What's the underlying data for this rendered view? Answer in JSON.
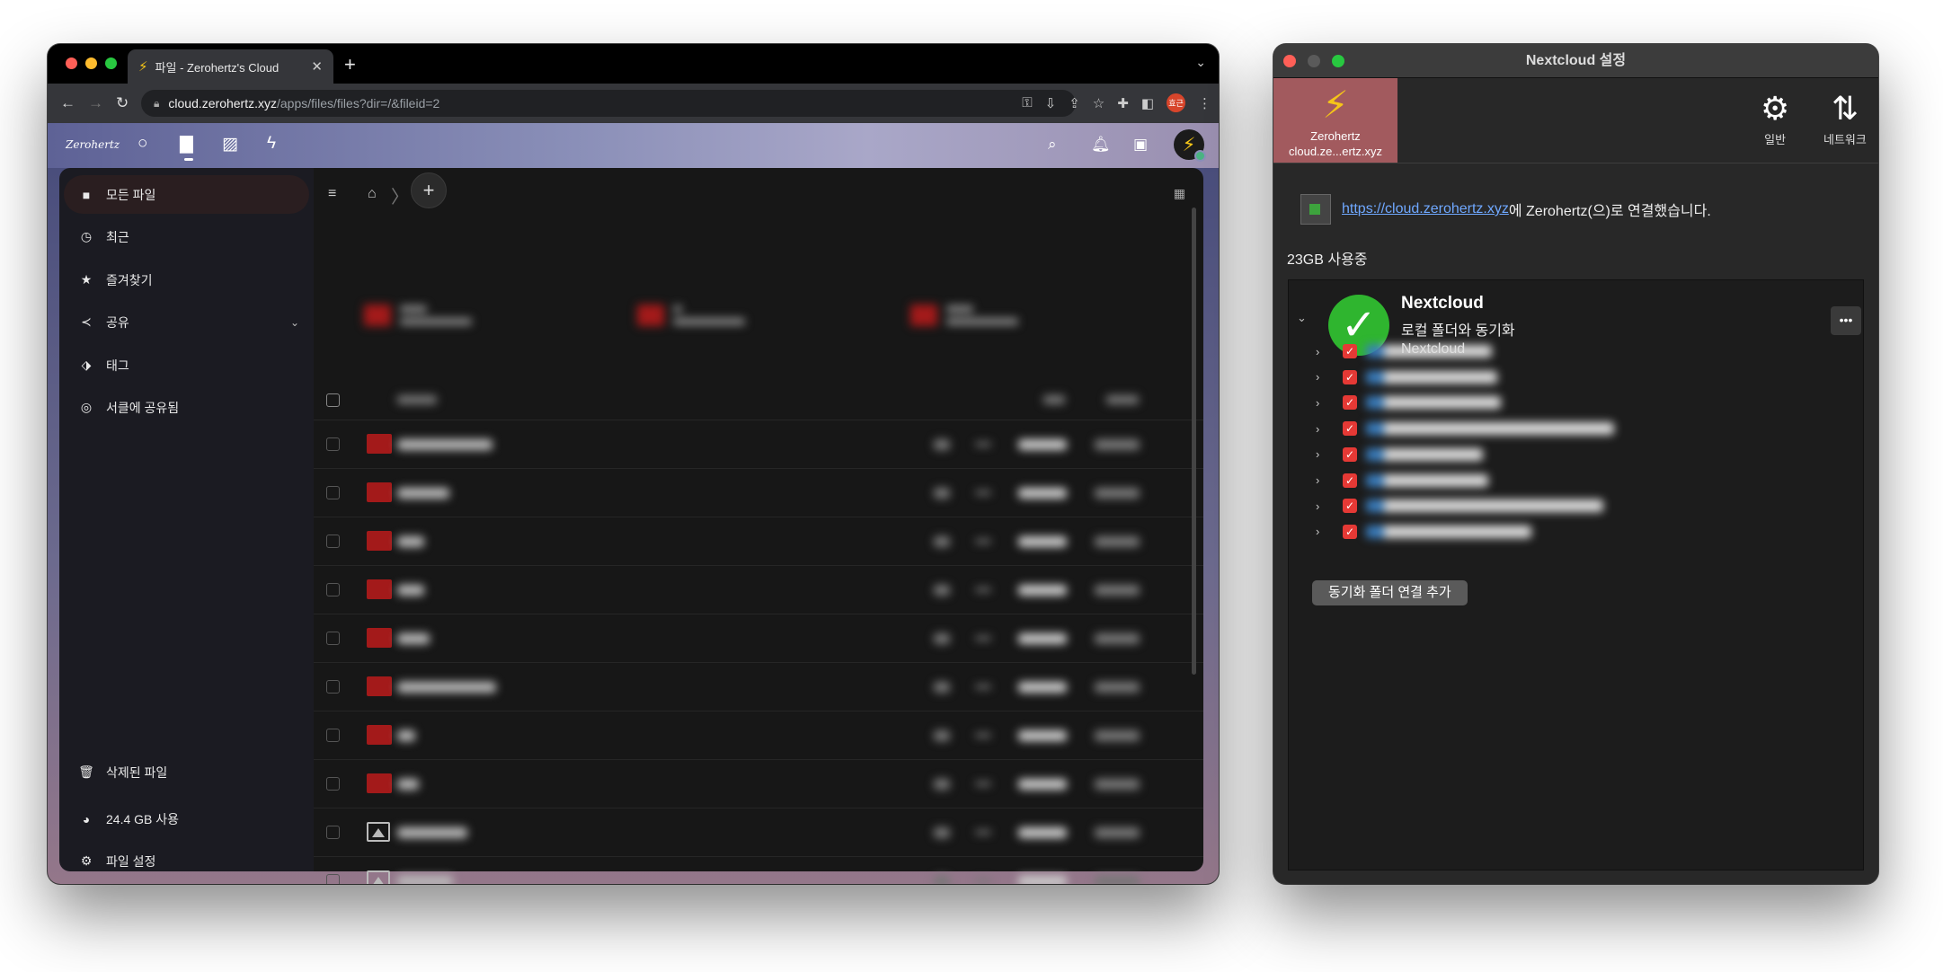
{
  "browser": {
    "tab_title": "파일 - Zerohertz's Cloud",
    "url_host": "cloud.zerohertz.xyz",
    "url_path": "/apps/files/files?dir=/&fileid=2",
    "profile_label": "효근"
  },
  "nextcloud": {
    "logo_text": "Zerohertz",
    "sidebar": {
      "items": [
        {
          "label": "모든 파일"
        },
        {
          "label": "최근"
        },
        {
          "label": "즐겨찾기"
        },
        {
          "label": "공유"
        },
        {
          "label": "태그"
        },
        {
          "label": "서클에 공유됨"
        }
      ],
      "bottom": [
        {
          "label": "삭제된 파일"
        },
        {
          "label": "24.4 GB 사용"
        },
        {
          "label": "파일 설정"
        }
      ]
    },
    "rows": [
      {
        "type": "folder"
      },
      {
        "type": "folder"
      },
      {
        "type": "folder"
      },
      {
        "type": "folder"
      },
      {
        "type": "folder"
      },
      {
        "type": "folder"
      },
      {
        "type": "folder"
      },
      {
        "type": "folder"
      },
      {
        "type": "image"
      },
      {
        "type": "image"
      }
    ]
  },
  "settings": {
    "window_title": "Nextcloud 설정",
    "account_name": "Zerohertz",
    "account_host": "cloud.ze...ertz.xyz",
    "general_label": "일반",
    "network_label": "네트워크",
    "connection_link": "https://cloud.zerohertz.xyz",
    "connection_text": "에 Zerohertz(으)로 연결했습니다.",
    "usage": "23GB 사용중",
    "sync_title": "Nextcloud",
    "sync_subtitle": "로컬 폴더와 동기화",
    "sync_remote": "Nextcloud",
    "folder_count": 8,
    "add_button": "동기화 폴더 연결 추가"
  }
}
